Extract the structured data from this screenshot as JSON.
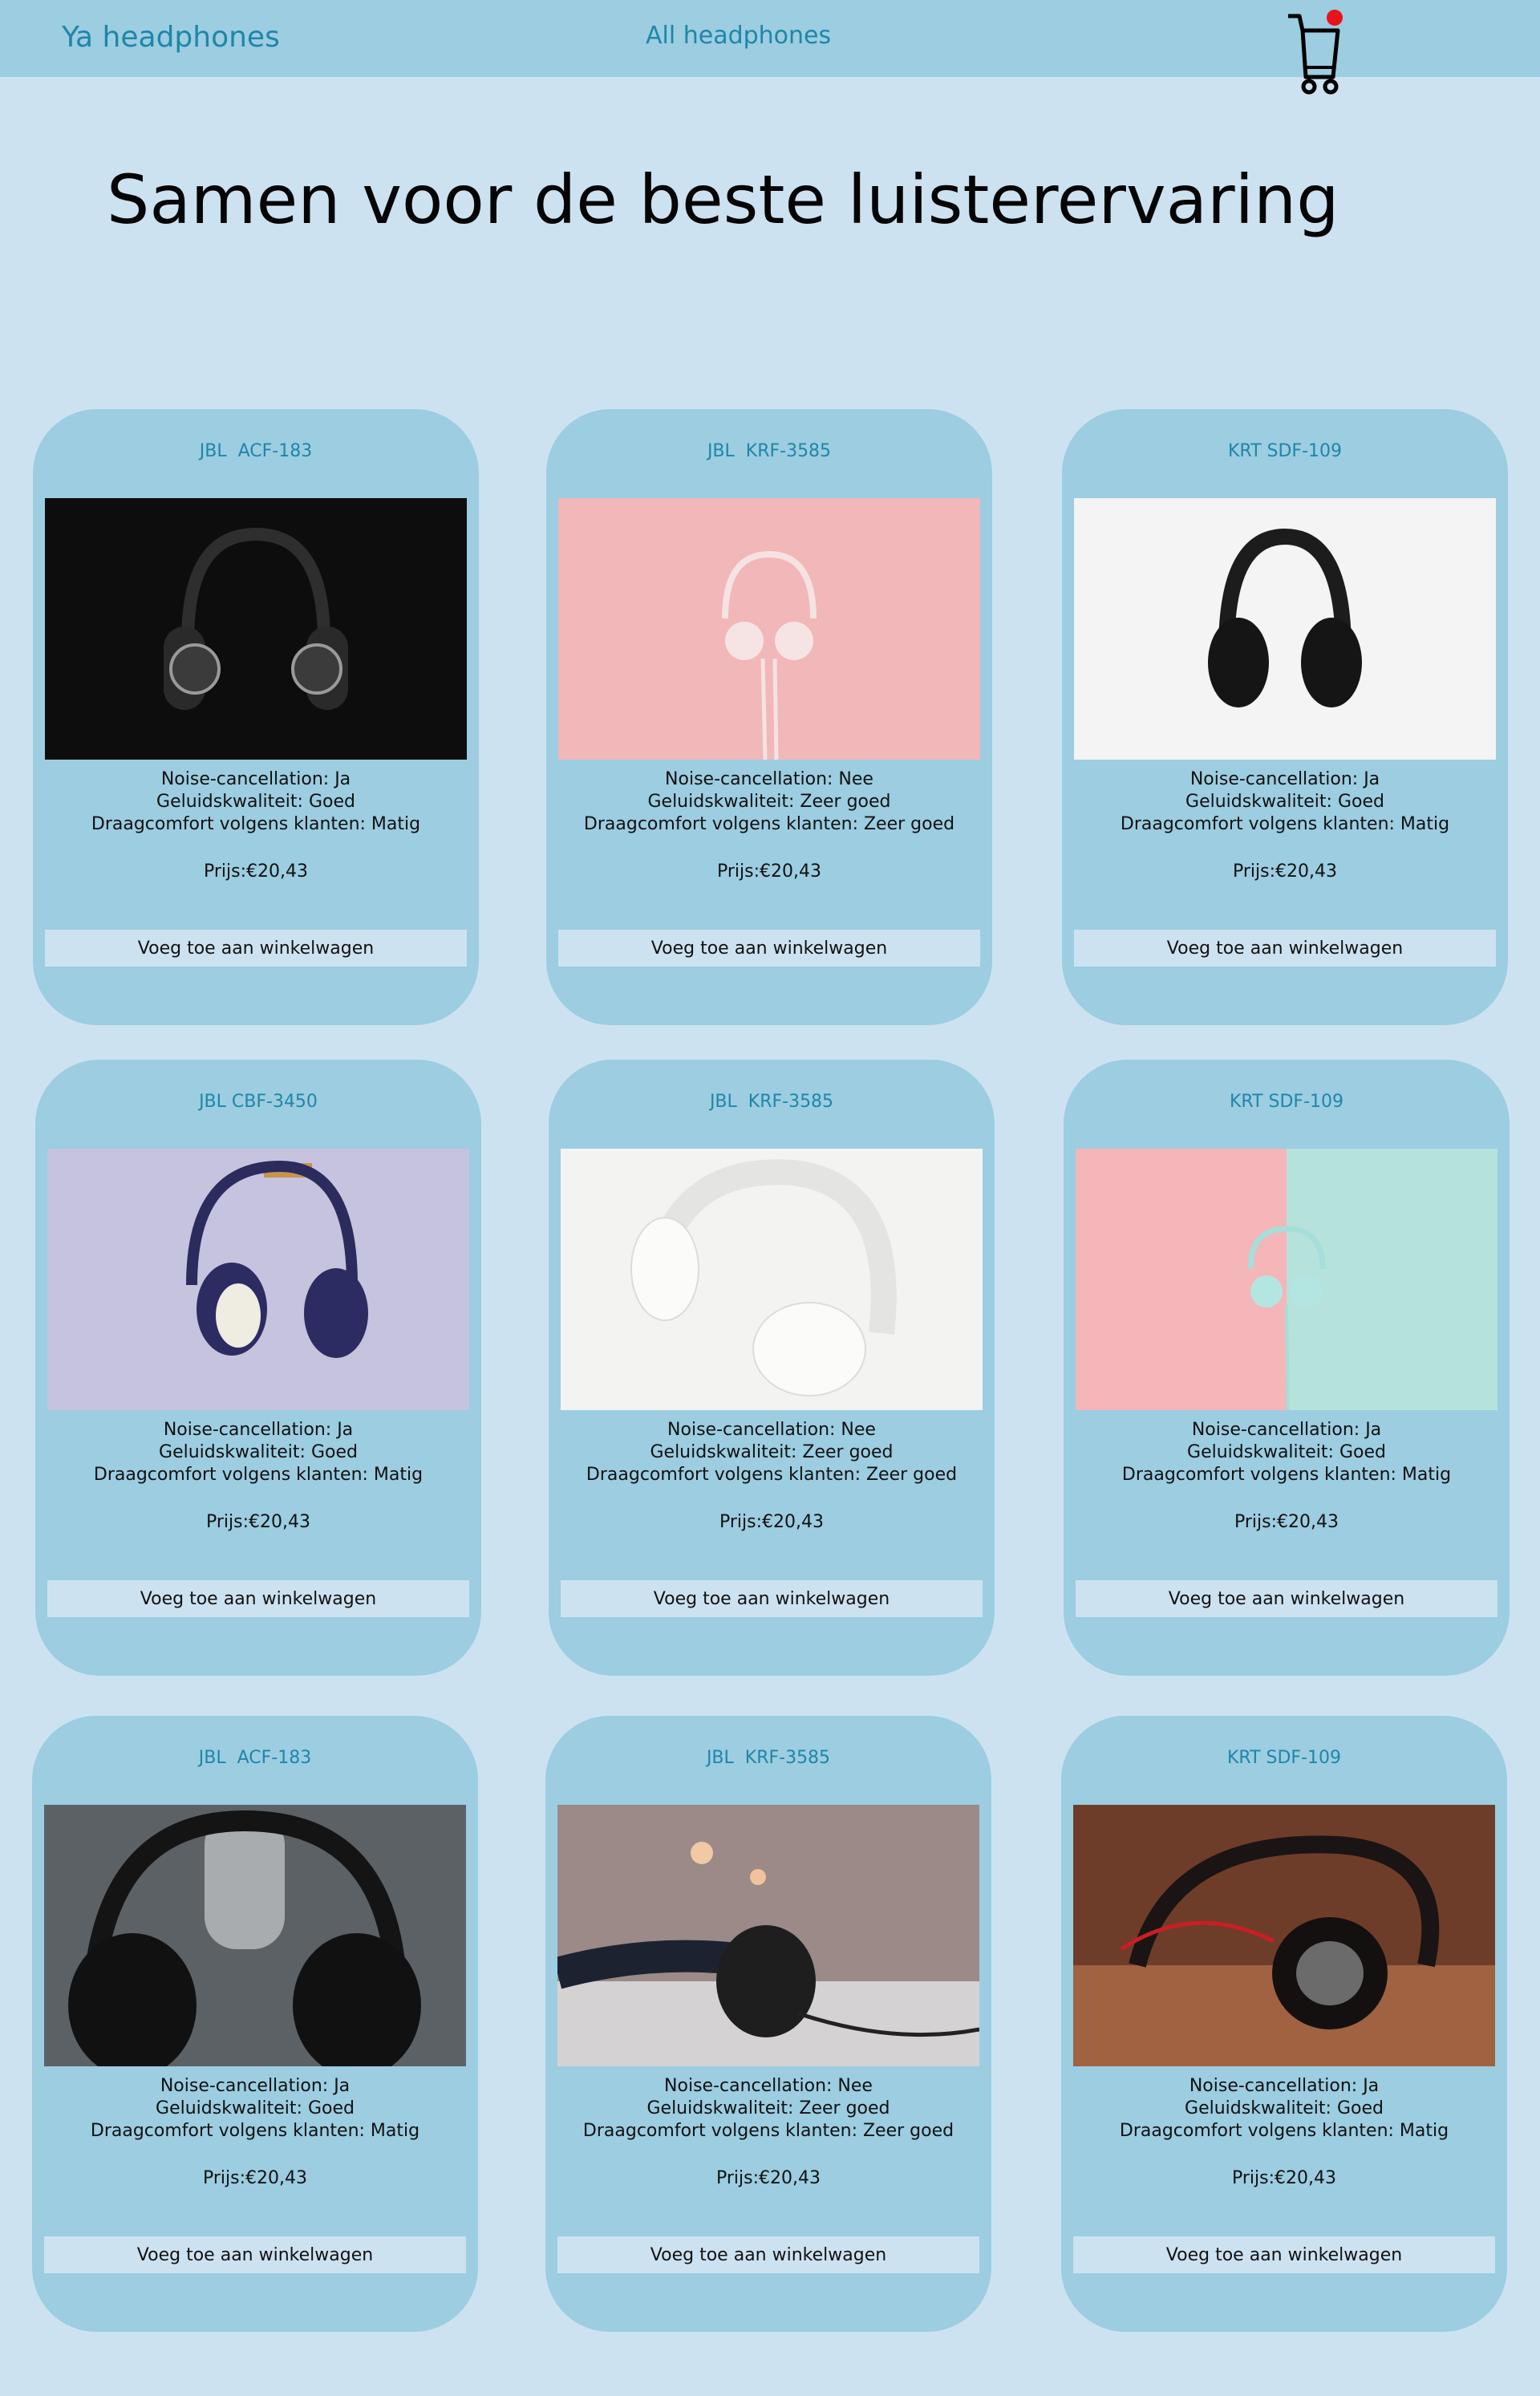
{
  "nav": {
    "brand": "Ya headphones",
    "link": "All headphones",
    "cart_icon": "shopping-cart-icon",
    "cart_badge_color": "#e8141b"
  },
  "hero": {
    "title": "Samen voor de beste luisterervaring"
  },
  "colors": {
    "page_background": "#cde2f0",
    "card_background": "#9ccde1",
    "accent_text": "#1f86a8"
  },
  "products": [
    {
      "name": "JBL  ACF-183",
      "noise": "Noise-cancellation: Ja",
      "quality": "Geluidskwaliteit: Goed",
      "comfort": "Draagcomfort volgens klanten: Matig",
      "price": "Prijs:€20,43",
      "button": "Voeg toe aan winkelwagen"
    },
    {
      "name": "JBL  KRF-3585",
      "noise": "Noise-cancellation: Nee",
      "quality": "Geluidskwaliteit: Zeer goed",
      "comfort": "Draagcomfort volgens klanten: Zeer goed",
      "price": "Prijs:€20,43",
      "button": "Voeg toe aan winkelwagen"
    },
    {
      "name": "KRT SDF-109",
      "noise": "Noise-cancellation: Ja",
      "quality": "Geluidskwaliteit: Goed",
      "comfort": "Draagcomfort volgens klanten: Matig",
      "price": "Prijs:€20,43",
      "button": "Voeg toe aan winkelwagen"
    },
    {
      "name": "JBL CBF-3450",
      "noise": "Noise-cancellation: Ja",
      "quality": "Geluidskwaliteit: Goed",
      "comfort": "Draagcomfort volgens klanten: Matig",
      "price": "Prijs:€20,43",
      "button": "Voeg toe aan winkelwagen"
    },
    {
      "name": "JBL  KRF-3585",
      "noise": "Noise-cancellation: Nee",
      "quality": "Geluidskwaliteit: Zeer goed",
      "comfort": "Draagcomfort volgens klanten: Zeer goed",
      "price": "Prijs:€20,43",
      "button": "Voeg toe aan winkelwagen"
    },
    {
      "name": "KRT SDF-109",
      "noise": "Noise-cancellation: Ja",
      "quality": "Geluidskwaliteit: Goed",
      "comfort": "Draagcomfort volgens klanten: Matig",
      "price": "Prijs:€20,43",
      "button": "Voeg toe aan winkelwagen"
    },
    {
      "name": "JBL  ACF-183",
      "noise": "Noise-cancellation: Ja",
      "quality": "Geluidskwaliteit: Goed",
      "comfort": "Draagcomfort volgens klanten: Matig",
      "price": "Prijs:€20,43",
      "button": "Voeg toe aan winkelwagen"
    },
    {
      "name": "JBL  KRF-3585",
      "noise": "Noise-cancellation: Nee",
      "quality": "Geluidskwaliteit: Zeer goed",
      "comfort": "Draagcomfort volgens klanten: Zeer goed",
      "price": "Prijs:€20,43",
      "button": "Voeg toe aan winkelwagen"
    },
    {
      "name": "KRT SDF-109",
      "noise": "Noise-cancellation: Ja",
      "quality": "Geluidskwaliteit: Goed",
      "comfort": "Draagcomfort volgens klanten: Matig",
      "price": "Prijs:€20,43",
      "button": "Voeg toe aan winkelwagen"
    }
  ]
}
